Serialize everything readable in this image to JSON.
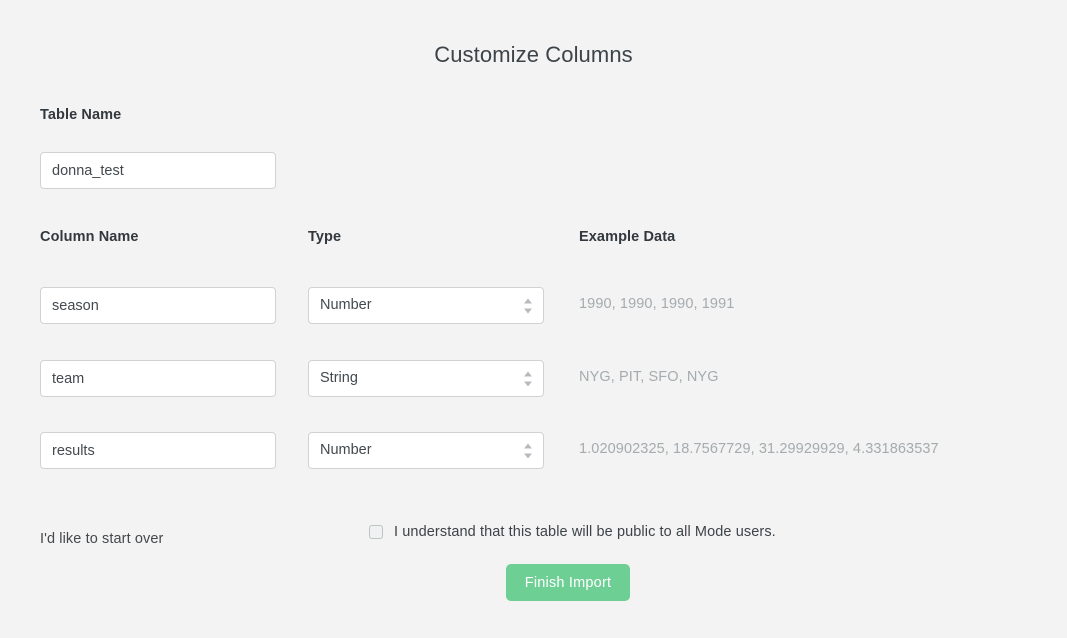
{
  "page": {
    "title": "Customize Columns"
  },
  "table_name": {
    "label": "Table Name",
    "value": "donna_test",
    "placeholder": "Table name"
  },
  "columns_section": {
    "headers": {
      "name": "Column Name",
      "type": "Type",
      "example": "Example Data"
    },
    "type_options": [
      "Number",
      "String"
    ],
    "rows": [
      {
        "name": "season",
        "type": "Number",
        "example": "1990, 1990, 1990, 1991"
      },
      {
        "name": "team",
        "type": "String",
        "example": "NYG, PIT, SFO, NYG"
      },
      {
        "name": "results",
        "type": "Number",
        "example": "1.020902325, 18.7567729, 31.29929929, 4.331863537"
      }
    ]
  },
  "footer": {
    "start_over_label": "I'd like to start over",
    "agreement_label": "I understand that this table will be public to all Mode users.",
    "agreement_checked": false,
    "submit_label": "Finish Import",
    "submit_color": "#6ecf94"
  }
}
